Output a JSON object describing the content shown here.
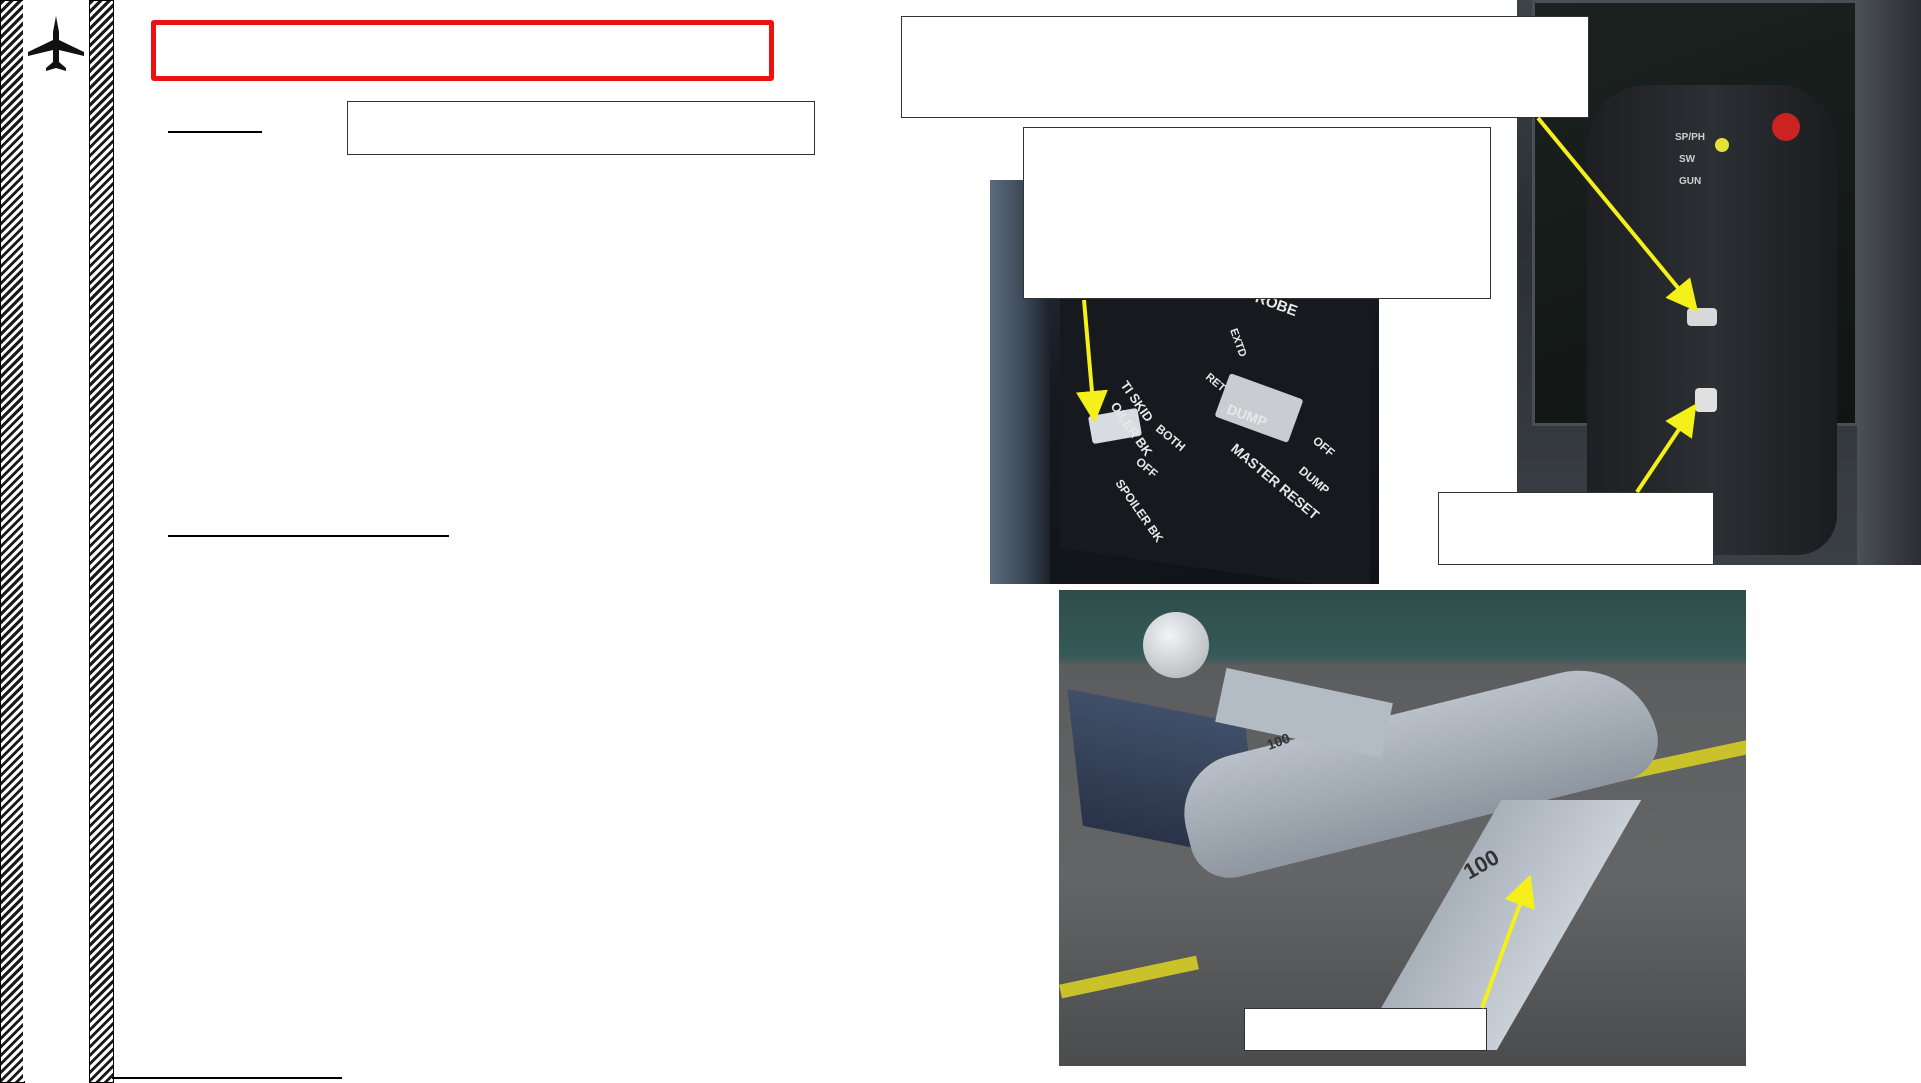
{
  "page": {
    "title": "",
    "subtitle": "",
    "section_heading": ""
  },
  "callouts": {
    "top": "",
    "panel": "",
    "stick": "",
    "jet": ""
  },
  "photos": {
    "panel": {
      "labels": [
        "PROBE",
        "EXTD",
        "RET",
        "TI SKID",
        "OILER BK",
        "BOTH",
        "OFF",
        "SPOILER BK",
        "DUMP",
        "MASTER RESET",
        "OFF",
        "DUMP"
      ]
    },
    "stick": {
      "labels": [
        "SP/PH",
        "SW",
        "GUN"
      ]
    },
    "jet": {
      "labels": [
        "100",
        "100"
      ]
    }
  },
  "icons": {
    "logo": "jet-silhouette-icon"
  },
  "colors": {
    "title_border": "#ee1111",
    "arrow": "#f5ef1a"
  }
}
